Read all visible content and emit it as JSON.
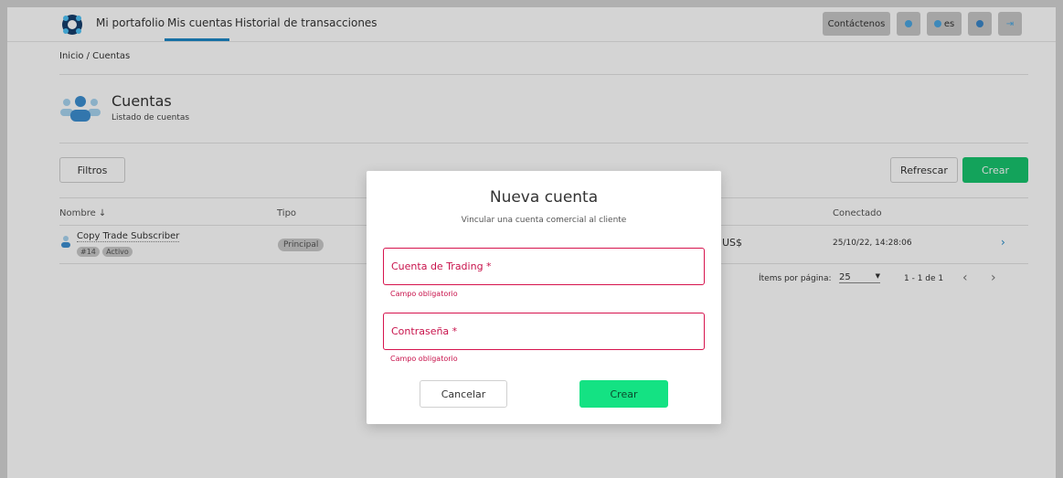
{
  "nav": {
    "items": [
      "Mi portafolio",
      "Mis cuentas",
      "Historial de transacciones"
    ],
    "contact_label": "Contáctenos",
    "language_label": "es"
  },
  "breadcrumb": "Inicio / Cuentas",
  "header": {
    "title": "Cuentas",
    "subtitle": "Listado de cuentas"
  },
  "toolbar": {
    "filters_label": "Filtros",
    "refresh_label": "Refrescar",
    "create_label": "Crear"
  },
  "table": {
    "columns": [
      "Nombre ↓",
      "Tipo",
      "Conectado"
    ],
    "rows": [
      {
        "name": "Copy Trade Subscriber",
        "id_badge": "#14",
        "status_badge": "Activo",
        "type_badge": "Principal",
        "currency": "US$",
        "connected": "25/10/22, 14:28:06"
      }
    ],
    "pagination": {
      "items_per_page_label": "Ítems por página:",
      "items_per_page_value": "25",
      "range": "1 - 1 de 1"
    }
  },
  "modal": {
    "title": "Nueva cuenta",
    "subtitle": "Vincular una cuenta comercial al cliente",
    "fields": [
      {
        "label": "Cuenta de Trading *",
        "error": "Campo obligatorio"
      },
      {
        "label": "Contraseña *",
        "error": "Campo obligatorio"
      }
    ],
    "cancel_label": "Cancelar",
    "create_label": "Crear"
  },
  "colors": {
    "primary_green": "#18c46e",
    "accent_blue": "#1e88c7",
    "error_red": "#d6134d"
  }
}
